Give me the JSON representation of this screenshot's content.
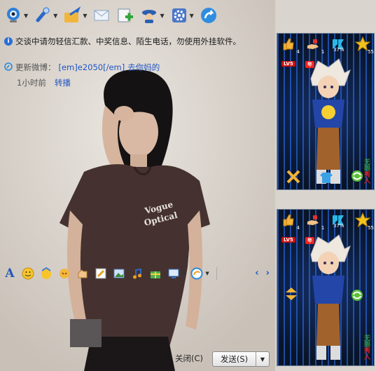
{
  "toolbar": {
    "items": [
      {
        "name": "video-call",
        "icon": "webcam-icon",
        "has_arrow": true
      },
      {
        "name": "voice-call",
        "icon": "microphone-icon",
        "has_arrow": true
      },
      {
        "name": "send-file",
        "icon": "folder-send-icon",
        "has_arrow": true
      },
      {
        "name": "send-sms",
        "icon": "envelope-icon",
        "has_arrow": false
      },
      {
        "name": "create-group",
        "icon": "add-contact-icon",
        "has_arrow": false
      },
      {
        "name": "remote-assist",
        "icon": "user-cap-icon",
        "has_arrow": true
      },
      {
        "name": "apps",
        "icon": "gear-icon",
        "has_arrow": true
      },
      {
        "name": "share",
        "icon": "share-icon",
        "has_arrow": false
      }
    ]
  },
  "notice": {
    "text": "交谈中请勿轻信汇款、中奖信息、陌生电话，勿使用外挂软件。"
  },
  "weibo": {
    "label": "更新微博：",
    "content": "[em]e2050[/em]",
    "link": "去你妈的",
    "time": "1小时前",
    "repost": "转播"
  },
  "format_bar": {
    "font_label": "A",
    "nav_prev": "‹",
    "nav_next": "›"
  },
  "footer": {
    "close_label": "关闭(C)",
    "send_label": "发送(S)"
  },
  "show_panel": {
    "level": "LV5",
    "badge": "年",
    "count_left": "4",
    "count_mid": "1",
    "percent": "37%",
    "star_count": "55",
    "watermark_a": "无限",
    "watermark_b": "秀人"
  },
  "colors": {
    "link": "#1f55c6",
    "show_bg": "#0b1b38",
    "accent_blue": "#2a6fd6"
  }
}
